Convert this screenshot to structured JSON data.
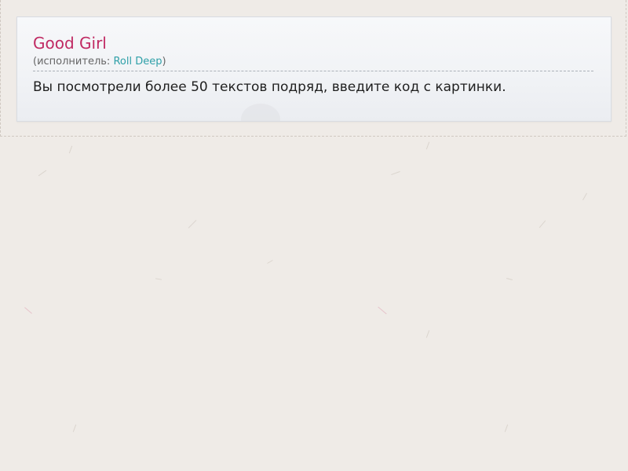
{
  "song": {
    "title": "Good Girl",
    "performer_prefix": "(исполнитель: ",
    "performer_name": "Roll Deep",
    "performer_suffix": ")"
  },
  "notice": {
    "message": "Вы посмотрели более 50 текстов подряд, введите код с картинки."
  },
  "colors": {
    "title": "#c02a63",
    "link": "#2fa0a8",
    "background": "#efebe7"
  }
}
